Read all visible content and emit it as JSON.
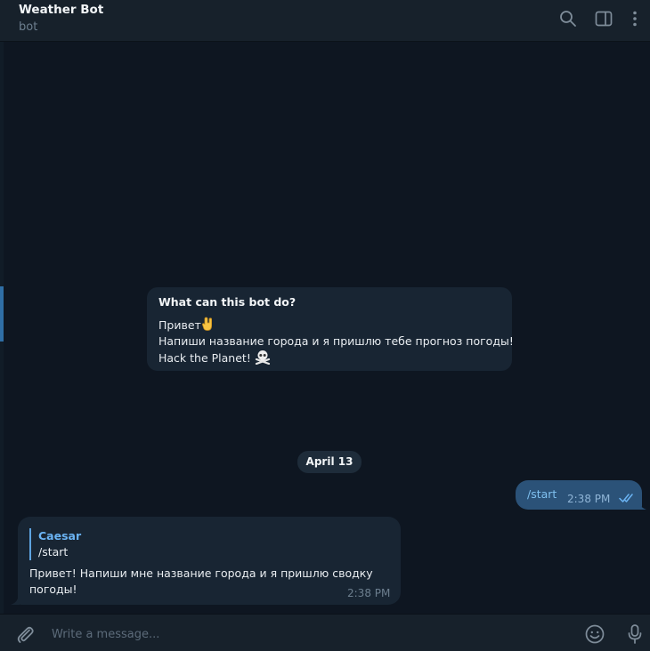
{
  "header": {
    "title": "Weather Bot",
    "subtitle": "bot",
    "icons": [
      "search-icon",
      "sidebar-toggle-icon",
      "more-vertical-icon"
    ]
  },
  "bot_intro": {
    "question": "What can this bot do?",
    "line1": "Привет",
    "line1_emoji": "rock-on-hand-emoji",
    "line2": "Напиши название города и я пришлю тебе прогноз погоды!",
    "line3": "Hack the Planet!",
    "line3_emoji": "skull-crossbones-emoji"
  },
  "date_separator": "April 13",
  "outgoing": {
    "text": "/start",
    "time": "2:38 PM",
    "status": "read"
  },
  "incoming": {
    "reply_to_name": "Caesar",
    "reply_to_text": "/start",
    "text": "Привет! Напиши мне название города и я пришлю сводку погоды!",
    "time": "2:38 PM"
  },
  "composer": {
    "placeholder": "Write a message...",
    "value": ""
  },
  "colors": {
    "background": "#0e1621",
    "panel": "#17212b",
    "incoming_bubble": "#182533",
    "outgoing_bubble": "#2b5278",
    "accent": "#6ab3f3"
  }
}
